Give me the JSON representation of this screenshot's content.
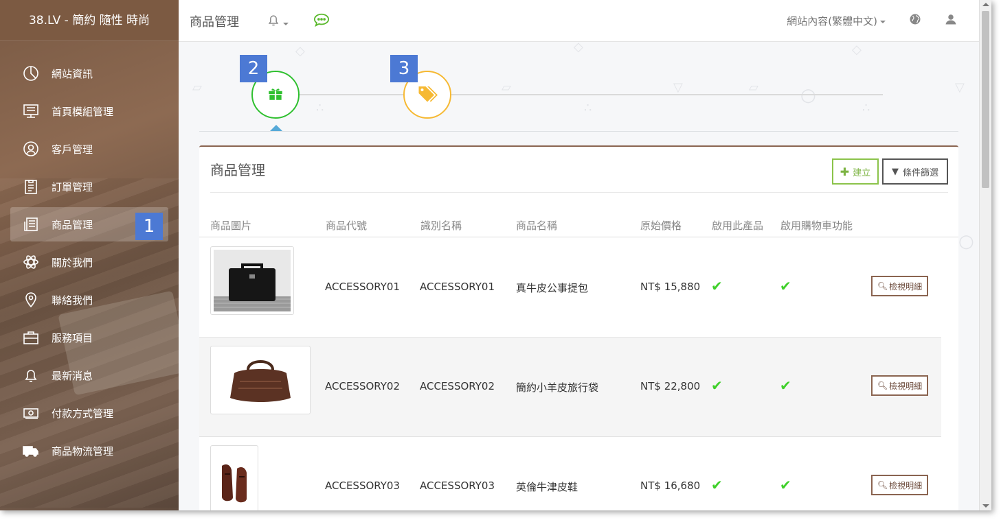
{
  "sidebar": {
    "brand": "38.LV - 簡約 隨性 時尚",
    "items": [
      {
        "label": "網站資訊",
        "icon": "pie-chart-icon"
      },
      {
        "label": "首頁模組管理",
        "icon": "monitor-icon"
      },
      {
        "label": "客戶管理",
        "icon": "user-circle-icon"
      },
      {
        "label": "訂單管理",
        "icon": "clipboard-icon"
      },
      {
        "label": "商品管理",
        "icon": "news-icon",
        "active": true
      },
      {
        "label": "關於我們",
        "icon": "atom-icon"
      },
      {
        "label": "聯絡我們",
        "icon": "map-pin-icon"
      },
      {
        "label": "服務項目",
        "icon": "briefcase-icon"
      },
      {
        "label": "最新消息",
        "icon": "bell-icon"
      },
      {
        "label": "付款方式管理",
        "icon": "money-icon"
      },
      {
        "label": "商品物流管理",
        "icon": "truck-icon"
      }
    ]
  },
  "topbar": {
    "title": "商品管理",
    "language": "網站內容(繁體中文)"
  },
  "badges": {
    "b1": "1",
    "b2": "2",
    "b3": "3"
  },
  "panel": {
    "title": "商品管理",
    "create_label": "建立",
    "filter_label": "條件篩選"
  },
  "table": {
    "headers": [
      "商品圖片",
      "商品代號",
      "識別名稱",
      "商品名稱",
      "原始價格",
      "啟用此產品",
      "啟用購物車功能"
    ],
    "rows": [
      {
        "code": "ACCESSORY01",
        "ident": "ACCESSORY01",
        "name": "真牛皮公事提包",
        "price": "NT$ 15,880",
        "enabled": "✔",
        "cart": "✔",
        "view": "檢視明細"
      },
      {
        "code": "ACCESSORY02",
        "ident": "ACCESSORY02",
        "name": "簡約小羊皮旅行袋",
        "price": "NT$ 22,800",
        "enabled": "✔",
        "cart": "✔",
        "view": "檢視明細"
      },
      {
        "code": "ACCESSORY03",
        "ident": "ACCESSORY03",
        "name": "英倫牛津皮鞋",
        "price": "NT$ 16,680",
        "enabled": "✔",
        "cart": "✔",
        "view": "檢視明細"
      }
    ]
  },
  "colors": {
    "accent_green": "#2fc02f",
    "accent_yellow": "#f6b933",
    "brand_brown": "#8a6450",
    "badge_blue": "#4c79d4"
  }
}
